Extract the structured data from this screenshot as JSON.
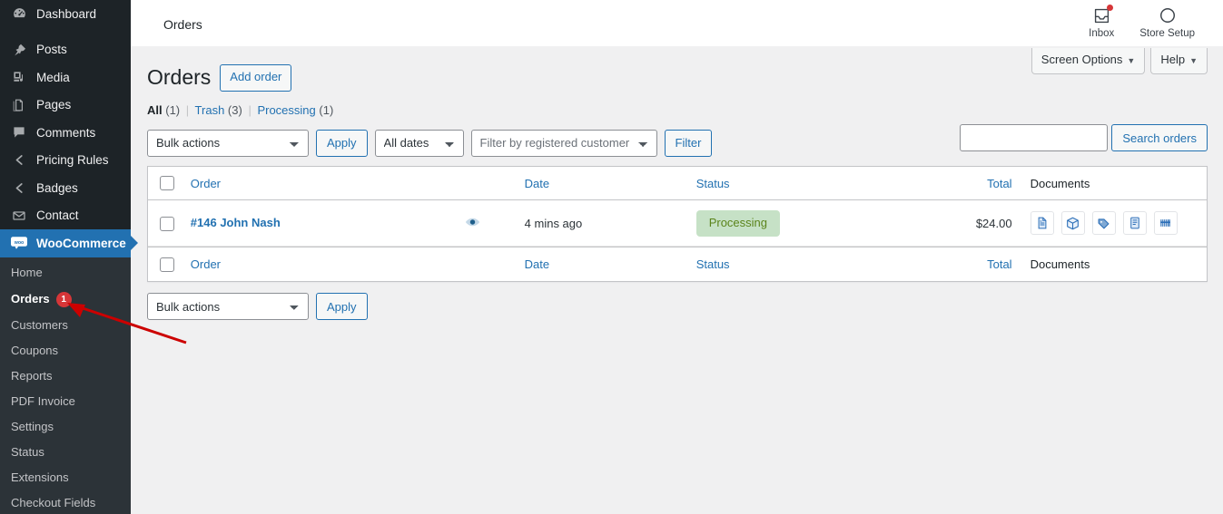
{
  "adminbar": {
    "title": "Orders",
    "inbox_label": "Inbox",
    "inbox_icon": "inbox-tray-icon",
    "store_setup_label": "Store Setup",
    "store_setup_icon": "progress-circle-icon"
  },
  "sidebar": {
    "items": [
      {
        "label": "Dashboard",
        "icon": "dashboard-icon"
      },
      {
        "label": "Posts",
        "icon": "pin-icon"
      },
      {
        "label": "Media",
        "icon": "media-icon"
      },
      {
        "label": "Pages",
        "icon": "pages-icon"
      },
      {
        "label": "Comments",
        "icon": "comment-bubble-icon"
      },
      {
        "label": "Pricing Rules",
        "icon": "chevron-left-icon"
      },
      {
        "label": "Badges",
        "icon": "chevron-left-icon"
      },
      {
        "label": "Contact",
        "icon": "envelope-icon"
      },
      {
        "label": "WooCommerce",
        "icon": "woocommerce-icon"
      }
    ],
    "active_item": "WooCommerce",
    "submenu": [
      {
        "label": "Home",
        "badge": null,
        "current": false
      },
      {
        "label": "Orders",
        "badge": "1",
        "current": true
      },
      {
        "label": "Customers",
        "badge": null,
        "current": false
      },
      {
        "label": "Coupons",
        "badge": null,
        "current": false
      },
      {
        "label": "Reports",
        "badge": null,
        "current": false
      },
      {
        "label": "PDF Invoice",
        "badge": null,
        "current": false
      },
      {
        "label": "Settings",
        "badge": null,
        "current": false
      },
      {
        "label": "Status",
        "badge": null,
        "current": false
      },
      {
        "label": "Extensions",
        "badge": null,
        "current": false
      },
      {
        "label": "Checkout Fields",
        "badge": null,
        "current": false
      }
    ],
    "colors": {
      "background": "#1d2327",
      "submenu_background": "#2c3338",
      "active": "#2271b1",
      "badge": "#d63638"
    }
  },
  "screen_meta": {
    "screen_options": "Screen Options",
    "help": "Help",
    "caret": "▼"
  },
  "page": {
    "title": "Orders",
    "add_order": "Add order"
  },
  "status_filters": [
    {
      "label": "All",
      "count": "(1)",
      "current": true
    },
    {
      "label": "Trash",
      "count": "(3)",
      "current": false
    },
    {
      "label": "Processing",
      "count": "(1)",
      "current": false
    }
  ],
  "search": {
    "value": "",
    "placeholder": "",
    "button": "Search orders"
  },
  "tablenav_top": {
    "bulk_actions": "Bulk actions",
    "apply": "Apply",
    "dates": "All dates",
    "customer_placeholder": "Filter by registered customer",
    "filter": "Filter"
  },
  "tablenav_bottom": {
    "bulk_actions": "Bulk actions",
    "apply": "Apply"
  },
  "table": {
    "columns": {
      "order": "Order",
      "date": "Date",
      "status": "Status",
      "total": "Total",
      "documents": "Documents"
    },
    "rows": [
      {
        "order": "#146 John Nash",
        "preview_icon": "eye-preview-icon",
        "date": "4 mins ago",
        "status": "Processing",
        "status_color": "#c6e1c6",
        "total": "$24.00",
        "documents": [
          "invoice-document-icon",
          "package-box-icon",
          "shipping-label-icon",
          "receipt-icon",
          "barcode-icon"
        ]
      }
    ]
  },
  "annotation": {
    "arrow_color": "#cc0000",
    "points_to": "Orders"
  }
}
